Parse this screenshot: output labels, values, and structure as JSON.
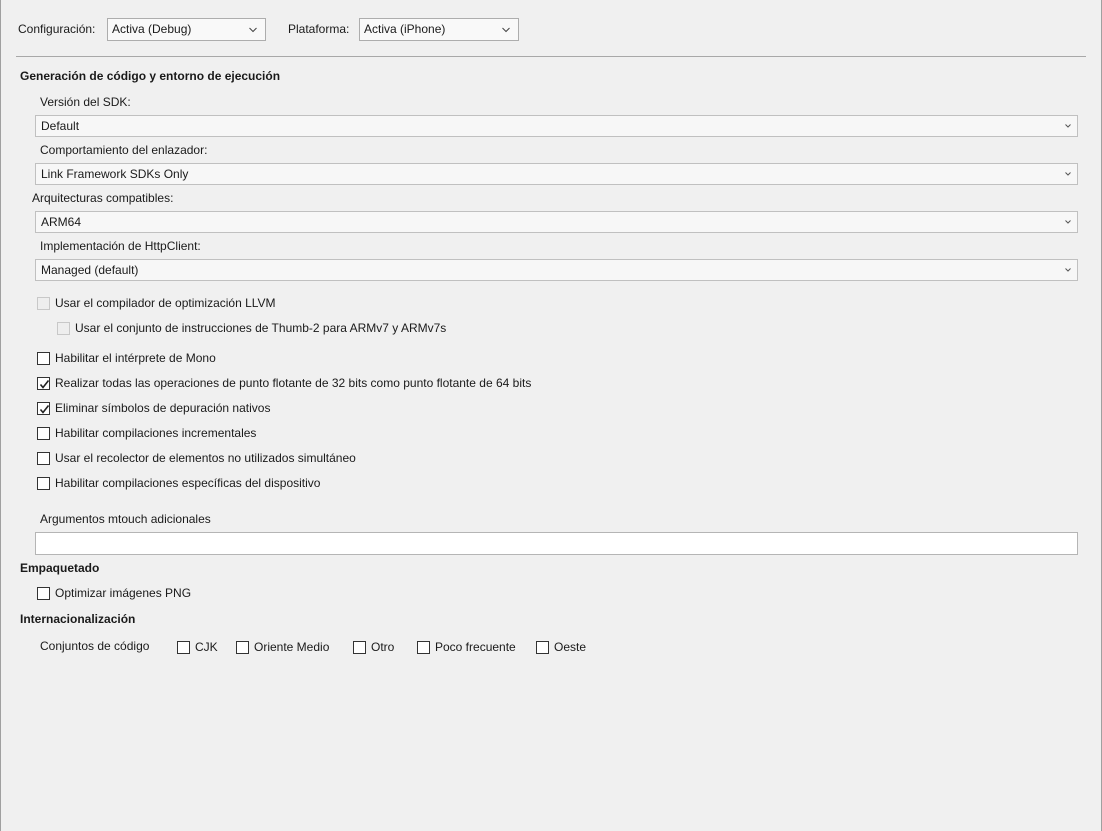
{
  "toolbar": {
    "config_label": "Configuración:",
    "config_value": "Activa (Debug)",
    "platform_label": "Plataforma:",
    "platform_value": "Activa (iPhone)"
  },
  "codegen": {
    "heading": "Generación de código y entorno de ejecución",
    "sdk_label": "Versión del SDK:",
    "sdk_value": "Default",
    "linker_label": "Comportamiento del enlazador:",
    "linker_value": "Link Framework SDKs Only",
    "arch_label": "Arquitecturas compatibles:",
    "arch_value": "ARM64",
    "httpclient_label": "Implementación de HttpClient:",
    "httpclient_value": "Managed (default)",
    "llvm_label": "Usar el compilador de optimización LLVM",
    "thumb_label": "Usar el conjunto de instrucciones de Thumb-2 para ARMv7 y ARMv7s",
    "options": [
      {
        "label": "Habilitar el intérprete de Mono",
        "checked": false
      },
      {
        "label": "Realizar todas las operaciones de punto flotante de 32 bits como punto flotante de 64 bits",
        "checked": true
      },
      {
        "label": "Eliminar símbolos de depuración nativos",
        "checked": true
      },
      {
        "label": "Habilitar compilaciones incrementales",
        "checked": false
      },
      {
        "label": "Usar el recolector de elementos no utilizados simultáneo",
        "checked": false
      },
      {
        "label": "Habilitar compilaciones específicas del dispositivo",
        "checked": false
      }
    ],
    "mtouch_label": "Argumentos mtouch adicionales",
    "mtouch_value": ""
  },
  "packaging": {
    "heading": "Empaquetado",
    "png_label": "Optimizar imágenes PNG"
  },
  "i18n": {
    "heading": "Internacionalización",
    "codesets_label": "Conjuntos de código",
    "codesets": [
      {
        "label": "CJK",
        "checked": false
      },
      {
        "label": "Oriente Medio",
        "checked": false
      },
      {
        "label": "Otro",
        "checked": false
      },
      {
        "label": "Poco frecuente",
        "checked": false
      },
      {
        "label": "Oeste",
        "checked": false
      }
    ]
  }
}
